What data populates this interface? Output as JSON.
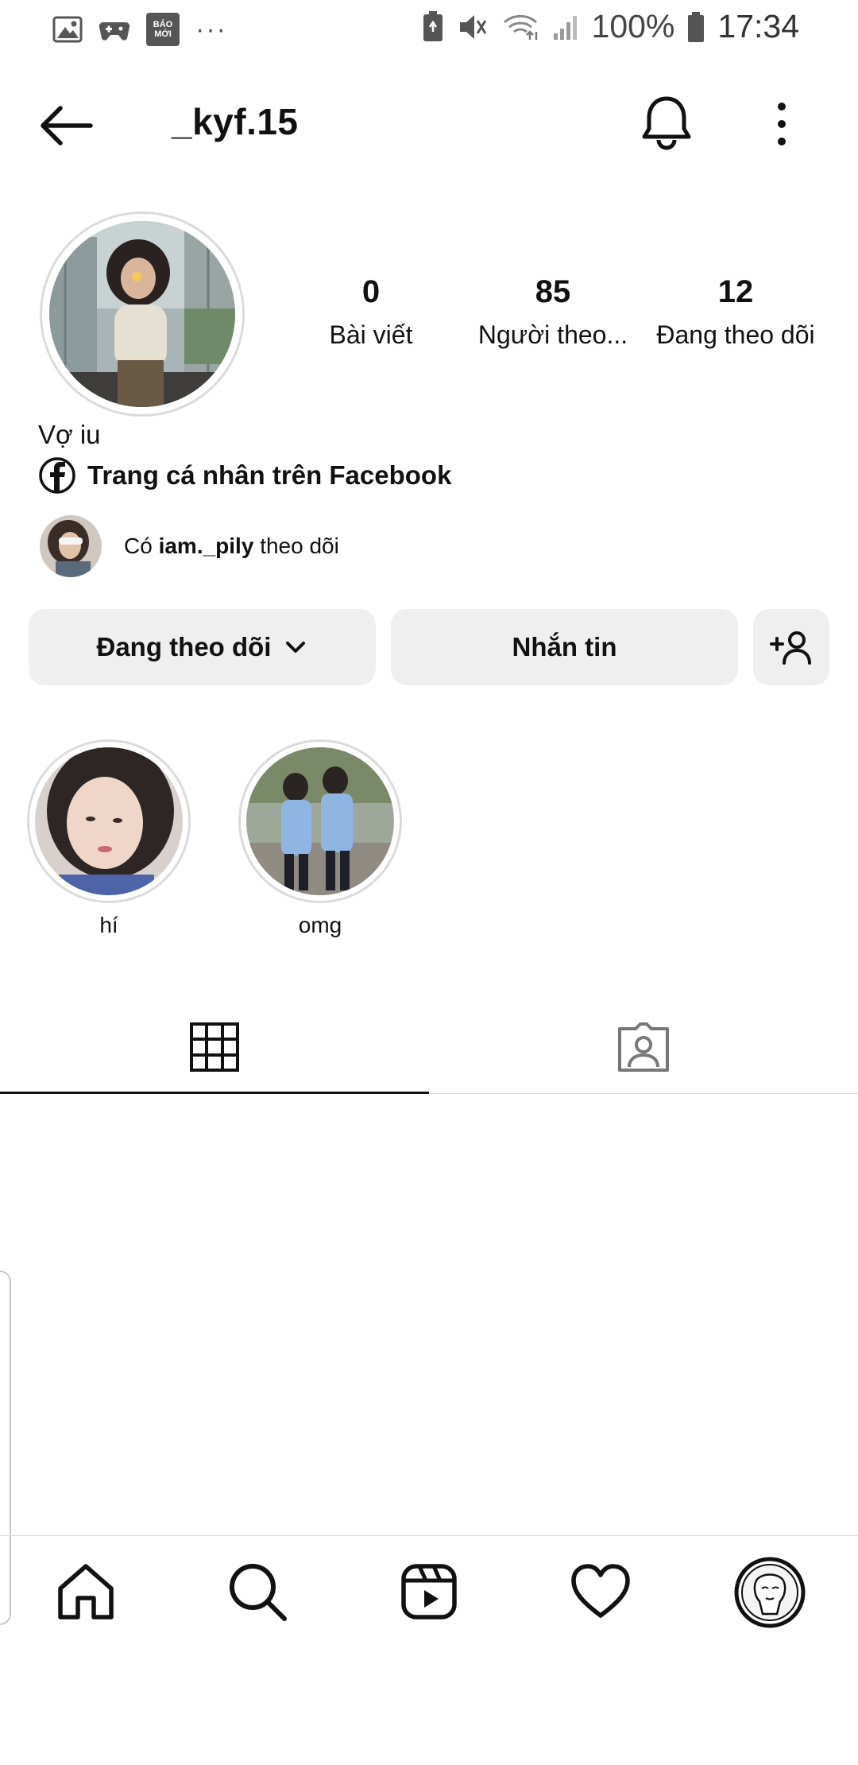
{
  "status_bar": {
    "notif_badge": "BÁO MỚI",
    "more": "···",
    "battery": "100%",
    "time": "17:34"
  },
  "header": {
    "username": "_kyf.15",
    "icons": [
      "back-arrow-icon",
      "bell-icon",
      "more-vertical-icon"
    ]
  },
  "stats": [
    {
      "value": "0",
      "label": "Bài viết"
    },
    {
      "value": "85",
      "label": "Người theo..."
    },
    {
      "value": "12",
      "label": "Đang theo dõi"
    }
  ],
  "bio": {
    "name": "Vợ iu",
    "facebook_link": "Trang cá nhân trên Facebook"
  },
  "mutual": {
    "prefix": "Có",
    "user": "iam._pily",
    "suffix": "theo dõi"
  },
  "actions": {
    "following": "Đang theo dõi",
    "message": "Nhắn tin"
  },
  "highlights": [
    {
      "label": "hí"
    },
    {
      "label": "omg"
    }
  ],
  "tabs": [
    "grid-icon",
    "tagged-icon"
  ],
  "bottom_nav": [
    "home-icon",
    "search-icon",
    "reels-icon",
    "heart-icon",
    "profile-avatar"
  ],
  "colors": {
    "button_bg": "#efefef",
    "divider": "#dbdbdb",
    "text": "#111111"
  }
}
